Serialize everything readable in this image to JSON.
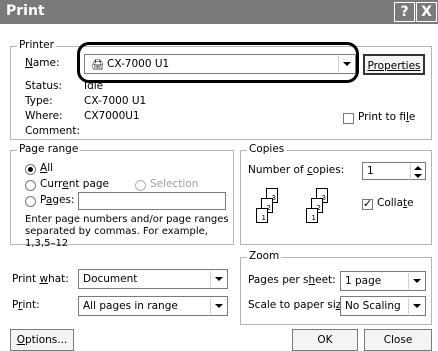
{
  "window": {
    "title": "Print",
    "help_glyph": "?",
    "close_glyph": "X"
  },
  "printer": {
    "group_label": "Printer",
    "name_label": "Name:",
    "name_value": "CX-7000 U1",
    "properties_label": "Properties",
    "status_label": "Status:",
    "status_value": "Idle",
    "type_label": "Type:",
    "type_value": "CX-7000 U1",
    "where_label": "Where:",
    "where_value": "CX7000U1",
    "comment_label": "Comment:",
    "comment_value": "",
    "print_to_file_label": "Print to file",
    "print_to_file_checked": false
  },
  "page_range": {
    "group_label": "Page range",
    "all_label": "All",
    "current_page_label": "Current page",
    "selection_label": "Selection",
    "pages_label": "Pages:",
    "pages_value": "",
    "hint": "Enter page numbers and/or page ranges separated by commas. For example, 1,3,5–12",
    "selected": "all"
  },
  "copies": {
    "group_label": "Copies",
    "number_label": "Number of copies:",
    "number_value": "1",
    "collate_label": "Collate",
    "collate_checked": true,
    "page_numbers": [
      "3",
      "2",
      "1",
      "3",
      "2",
      "1"
    ]
  },
  "print_what": {
    "label": "Print what:",
    "value": "Document"
  },
  "print": {
    "label": "Print:",
    "value": "All pages in range"
  },
  "zoom": {
    "group_label": "Zoom",
    "pages_per_sheet_label": "Pages per sheet:",
    "pages_per_sheet_value": "1 page",
    "scale_label": "Scale to paper size:",
    "scale_value": "No Scaling"
  },
  "footer": {
    "options_label": "Options...",
    "ok_label": "OK",
    "close_label": "Close"
  },
  "colors": {
    "titlebar": "#7a7a7a",
    "highlight": "#000000"
  }
}
